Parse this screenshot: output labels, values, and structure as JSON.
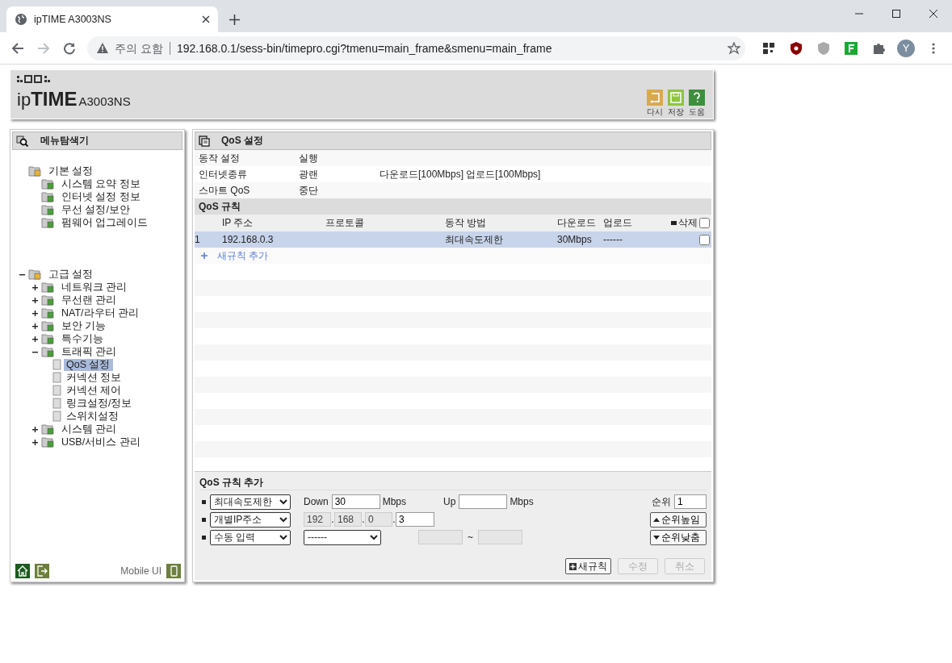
{
  "browser": {
    "tab_title": "ipTIME A3003NS",
    "security_label": "주의 요함",
    "url": "192.168.0.1/sess-bin/timepro.cgi?tmenu=main_frame&smenu=main_frame",
    "profile_initial": "Y"
  },
  "header": {
    "logo": "ip**TIME**",
    "model": "A3003NS",
    "buttons": [
      {
        "label": "다시",
        "kind": "undo",
        "color": "#d9a94f"
      },
      {
        "label": "저장",
        "kind": "save",
        "color": "#8fc440"
      },
      {
        "label": "도움",
        "kind": "help",
        "color": "#3d8f3d"
      }
    ]
  },
  "sidebar": {
    "title": "메뉴탐색기",
    "tree": [
      {
        "label": "기본 설정",
        "selected": false,
        "children": [
          {
            "label": "시스템 요약 정보",
            "selected": false
          },
          {
            "label": "인터넷 설정 정보",
            "selected": false
          },
          {
            "label": "무선 설정/보안",
            "selected": false
          },
          {
            "label": "펌웨어 업그레이드",
            "selected": false
          }
        ]
      },
      {
        "label": "고급 설정",
        "selected": false,
        "expanded": true,
        "children": [
          {
            "label": "네트워크 관리",
            "selected": false,
            "expanded": false
          },
          {
            "label": "무선랜 관리",
            "selected": false,
            "expanded": false
          },
          {
            "label": "NAT/라우터 관리",
            "selected": false,
            "expanded": false
          },
          {
            "label": "보안 기능",
            "selected": false,
            "expanded": false
          },
          {
            "label": "특수기능",
            "selected": false,
            "expanded": false
          },
          {
            "label": "트래픽 관리",
            "selected": false,
            "expanded": true,
            "children": [
              {
                "label": "QoS 설정",
                "selected": true
              },
              {
                "label": "커넥션 정보",
                "selected": false
              },
              {
                "label": "커넥션 제어",
                "selected": false
              },
              {
                "label": "링크설정/정보",
                "selected": false
              },
              {
                "label": "스위치설정",
                "selected": false
              }
            ]
          },
          {
            "label": "시스템 관리",
            "selected": false,
            "expanded": false
          },
          {
            "label": "USB/서비스 관리",
            "selected": false,
            "expanded": false
          }
        ]
      }
    ],
    "footer_label": "Mobile UI"
  },
  "main": {
    "title": "QoS 설정",
    "status": [
      {
        "label": "동작 설정",
        "value": "실행"
      },
      {
        "label": "인터넷종류",
        "value": "광랜",
        "detail": "다운로드[100Mbps] 업로드[100Mbps]"
      },
      {
        "label": "스마트 QoS",
        "value": "중단"
      }
    ],
    "rules": {
      "title": "QoS 규칙",
      "columns": [
        "IP 주소",
        "프로토콜",
        "동작 방법",
        "다운로드",
        "업로드",
        "삭제"
      ],
      "select_all_checked": false,
      "rows": [
        {
          "index": "1",
          "ip": "192.168.0.3",
          "action": "최대속도제한",
          "download": "30Mbps",
          "upload": "------",
          "checked": false,
          "selected": true
        }
      ],
      "add_link": "새규칙 추가"
    },
    "form": {
      "title": "QoS 규칙 추가",
      "mode_select": "최대속도제한",
      "down_label": "Down",
      "down_value": "30",
      "down_unit": "Mbps",
      "up_label": "Up",
      "up_unit": "Mbps",
      "priority_label": "순위",
      "priority_value": "1",
      "address_select": "개별IP주소",
      "ip_separator": ".",
      "ip_octets": [
        {
          "value": "192",
          "disabled": true
        },
        {
          "value": "168",
          "disabled": true
        },
        {
          "value": "0",
          "disabled": true
        },
        {
          "value": "3",
          "disabled": false
        }
      ],
      "protocol_select": "수동 입력",
      "port_select": "------",
      "port_range": [
        {
          "disabled": true
        },
        {
          "disabled": true
        }
      ],
      "range_separator": "~",
      "priority_up": "순위높임",
      "priority_down": "순위낮춤",
      "buttons": [
        {
          "label": "새규칙",
          "kind": "add",
          "disabled": false
        },
        {
          "label": "수정",
          "kind": "plain",
          "disabled": true
        },
        {
          "label": "취소",
          "kind": "plain",
          "disabled": true
        }
      ]
    }
  }
}
